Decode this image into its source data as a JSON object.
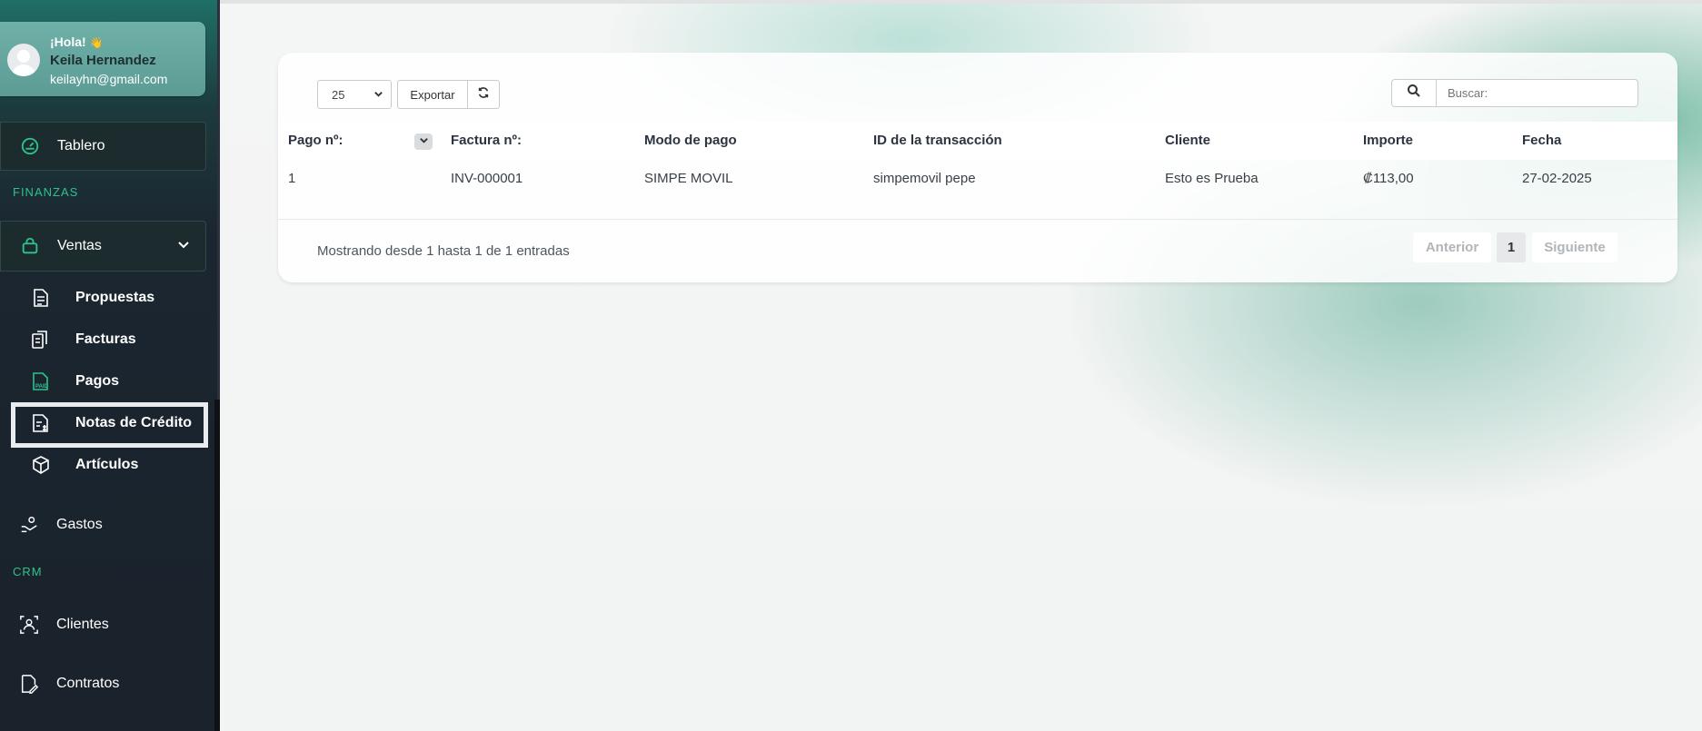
{
  "profile": {
    "greeting": "¡Hola!",
    "wave": "👋",
    "name": "Keila Hernandez",
    "email": "keilayhn@gmail.com"
  },
  "sidebar": {
    "dashboard": "Tablero",
    "section_finance": "FINANZAS",
    "sales": "Ventas",
    "sales_items": [
      {
        "label": "Propuestas",
        "icon": "proposal-icon"
      },
      {
        "label": "Facturas",
        "icon": "invoice-icon"
      },
      {
        "label": "Pagos",
        "icon": "payment-icon"
      },
      {
        "label": "Notas de Crédito",
        "icon": "credit-note-icon"
      },
      {
        "label": "Artículos",
        "icon": "items-icon"
      }
    ],
    "expenses": "Gastos",
    "section_crm": "CRM",
    "clients": "Clientes",
    "contracts": "Contratos"
  },
  "toolbar": {
    "page_size": "25",
    "export": "Exportar",
    "search_placeholder": "Buscar:"
  },
  "table": {
    "headers": [
      "Pago nº:",
      "Factura nº:",
      "Modo de pago",
      "ID de la transacción",
      "Cliente",
      "Importe",
      "Fecha"
    ],
    "rows": [
      [
        "1",
        "INV-000001",
        "SIMPE MOVIL",
        "simpemovil pepe",
        "Esto es Prueba",
        "₡113,00",
        "27-02-2025"
      ]
    ]
  },
  "footer": {
    "info": "Mostrando desde 1 hasta 1 de 1 entradas",
    "prev": "Anterior",
    "current_page": "1",
    "next": "Siguiente"
  },
  "colors": {
    "accent": "#2ec28d",
    "sidebar_bg": "#1a222b"
  }
}
